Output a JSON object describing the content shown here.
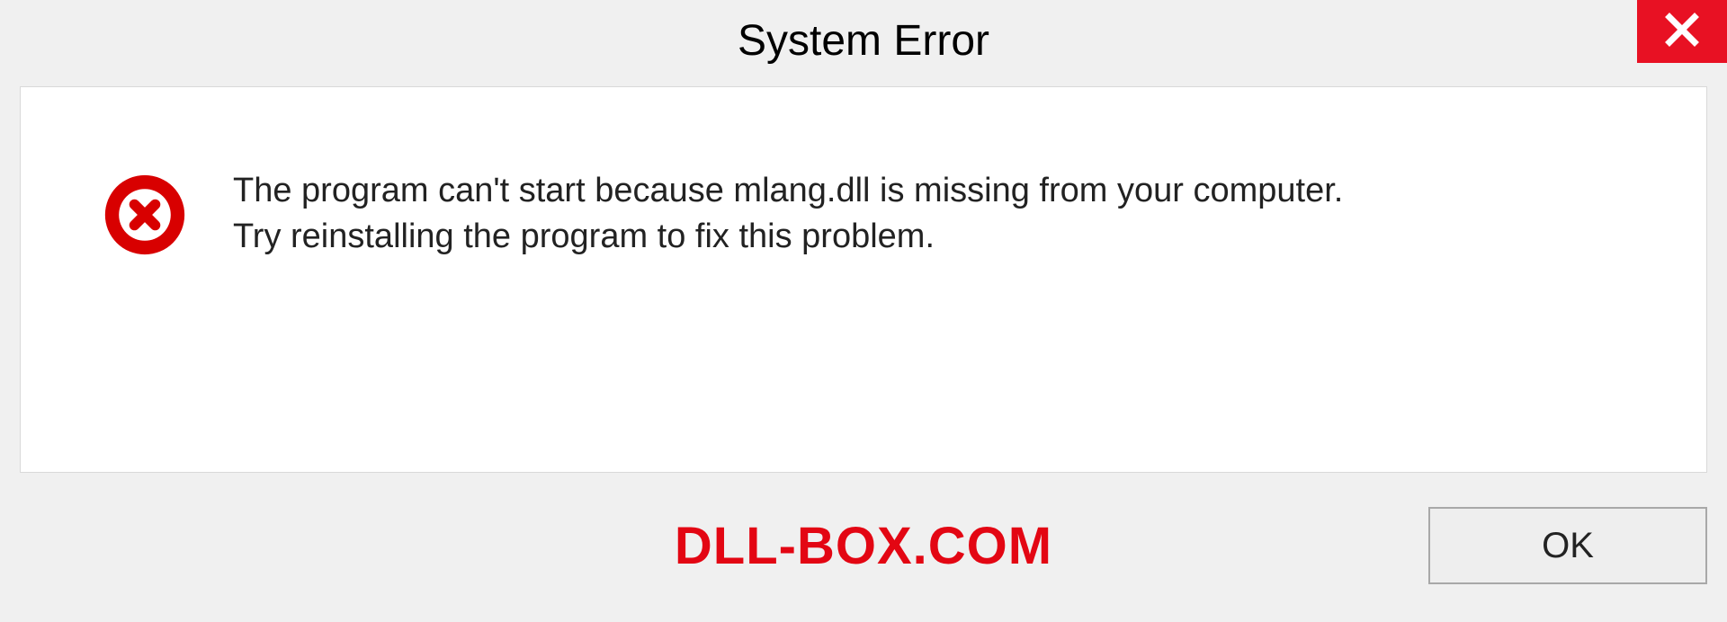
{
  "header": {
    "title": "System Error"
  },
  "dialog": {
    "message_line1": "The program can't start because mlang.dll is missing from your computer.",
    "message_line2": "Try reinstalling the program to fix this problem."
  },
  "footer": {
    "ok_label": "OK",
    "watermark": "DLL-BOX.COM"
  },
  "colors": {
    "close_bg": "#e81123",
    "error_icon": "#d80000",
    "watermark": "#e30613"
  }
}
